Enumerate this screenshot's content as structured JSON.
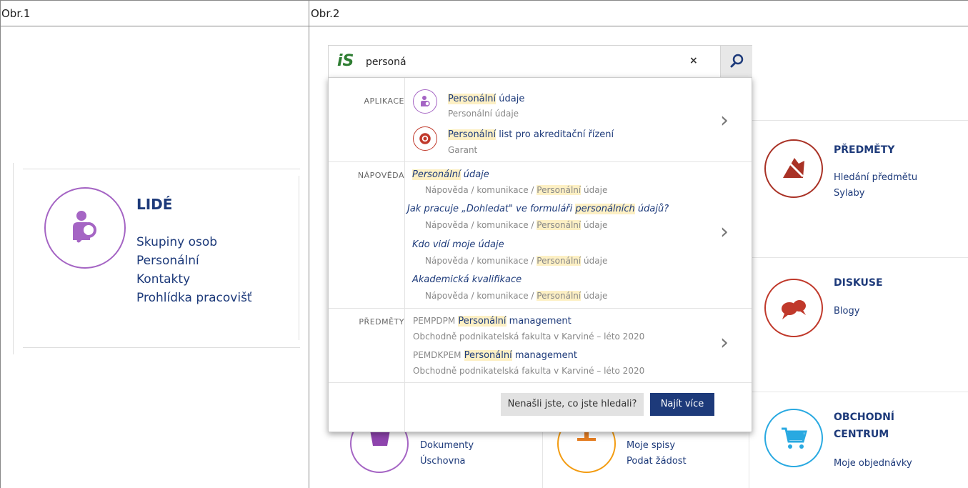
{
  "panels": {
    "left_label": "Obr.1",
    "right_label": "Obr.2"
  },
  "lide": {
    "title": "LIDÉ",
    "links": [
      "Skupiny osob",
      "Personální",
      "Kontakty",
      "Prohlídka pracovišť"
    ]
  },
  "search": {
    "logo": "iS",
    "value": "personá",
    "clear_glyph": "×"
  },
  "dropdown": {
    "aplikace": {
      "label": "APLIKACE",
      "items": [
        {
          "hl": "Personální",
          "rest": " údaje",
          "sub": "Personální údaje"
        },
        {
          "hl": "Personální",
          "rest": " list pro akreditační řízení",
          "sub": "Garant"
        }
      ]
    },
    "napoveda": {
      "label": "NÁPOVĚDA",
      "items": [
        {
          "pre": "",
          "hl": "Personální",
          "rest": " údaje"
        },
        {
          "pre": "Jak pracuje „Dohledat\" ve formuláři ",
          "hl": "personálních",
          "rest": " údajů?"
        },
        {
          "pre": "Kdo vidí moje údaje",
          "hl": "",
          "rest": ""
        },
        {
          "pre": "Akademická kvalifikace",
          "hl": "",
          "rest": ""
        }
      ],
      "path_pre": "Nápověda / komunikace / ",
      "path_hl": "Personální",
      "path_post": " údaje"
    },
    "predmety": {
      "label": "PŘEDMĚTY",
      "items": [
        {
          "code": "PEMPDPM",
          "hl": "Personální",
          "rest": " management",
          "sub": "Obchodně podnikatelská fakulta v Karviné – léto 2020"
        },
        {
          "code": "PEMDKPEM",
          "hl": "Personální",
          "rest": " management",
          "sub": "Obchodně podnikatelská fakulta v Karviné – léto 2020"
        }
      ]
    },
    "not_found_button": "Nenašli jste, co jste hledali?",
    "more_button": "Najít více",
    "chevron": "›"
  },
  "cards": {
    "predmety": {
      "title": "PŘEDMĚTY",
      "links": [
        "Hledání předmětu",
        "Sylaby"
      ]
    },
    "diskuse": {
      "title": "DISKUSE",
      "links": [
        "Blogy"
      ]
    },
    "obchod": {
      "title1": "OBCHODNÍ",
      "title2": "CENTRUM",
      "links": [
        "Moje objednávky"
      ]
    },
    "dokumenty": {
      "links": [
        "Dokumenty",
        "Úschovna"
      ]
    },
    "spisy": {
      "links": [
        "Moje spisy",
        "Podat žádost"
      ]
    }
  },
  "colors": {
    "brand_blue": "#1d3a7a",
    "purple": "#a565c4",
    "red": "#c0392b",
    "cyan": "#29a9e1",
    "orange": "#f39c12",
    "highlight": "#fdf0c4"
  }
}
